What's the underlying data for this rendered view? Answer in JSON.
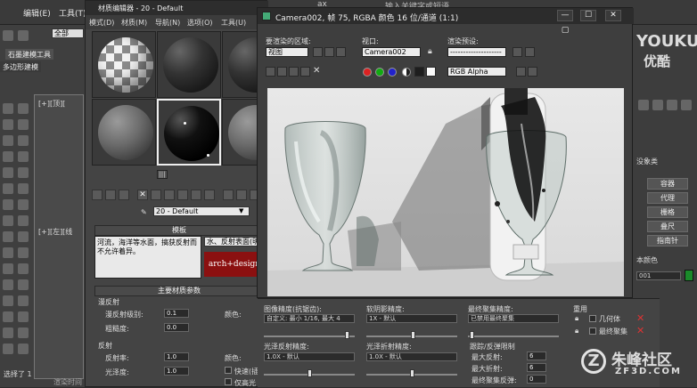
{
  "app": {
    "menu": [
      "编辑(E)",
      "工具(T)"
    ],
    "ribbon_tabs": [
      "石墨建模工具",
      "多边形建模"
    ],
    "field_all": "全部",
    "viewport_labels": [
      "[+][顶][",
      "[+][左][线"
    ],
    "status_text": "选择了 1 ",
    "right_panel_buttons": [
      "容器",
      "代理",
      "栅格",
      "叠尺",
      "指南针"
    ],
    "right_panel_labels": [
      "没象类",
      "本颜色",
      "001"
    ],
    "tab_label": "ax",
    "top_hint": "输入关键字或短语"
  },
  "material_editor": {
    "title": "材质编辑器 - 20 - Default",
    "menu": [
      "模式(D)",
      "材质(M)",
      "导航(N)",
      "选项(O)",
      "工具(U)"
    ],
    "material_name": "20 - Default",
    "rollout_template": "模板",
    "template_text": "河流，海洋等水面，搞获反射而不允许着异。",
    "shader_text": "水、反射表面(明",
    "logo_text": "arch+design",
    "rollout_main": "主要材质参数",
    "section_diffuse": "漫反射",
    "diffuse_level_label": "漫反射级别:",
    "diffuse_level_value": "0.1",
    "roughness_label": "粗糙度:",
    "roughness_value": "0.0",
    "color_label": "颜色:",
    "section_reflect": "反射",
    "reflect_label": "反射率:",
    "reflect_value": "1.0",
    "gloss_label": "光泽度:",
    "gloss_value": "1.0",
    "fast_label": "快速(插",
    "highlight_label": "仅高光",
    "status_small": "渲染时间"
  },
  "render_window": {
    "title": "Camera002, 帧 75, RGBA 颜色 16 位/通道 (1:1)",
    "area_label": "要渲染的区域:",
    "area_value": "视图",
    "viewport_label": "视口:",
    "viewport_value": "Camera002",
    "preset_label": "渲染预设:",
    "preset_value": "--------------------",
    "channel_value": "RGB Alpha",
    "minimize_icon": "—",
    "maximize_icon": "☐",
    "close_icon": "✕",
    "win_extra_icon": "▢"
  },
  "render_settings": {
    "aa_label": "图像精度(抗锯齿):",
    "aa_value": "自定义: 最小 1/16, 最大 4",
    "soft_shadow_label": "软阴影精度:",
    "soft_shadow_value": "1X - 默认",
    "final_gather_label": "最终聚集精度:",
    "final_gather_value": "已禁用最终聚集",
    "reuse_label": "重用",
    "geom_label": "几何体",
    "fg_label": "最终聚集",
    "glossy_reflect_label": "光泽反射精度:",
    "glossy_reflect_value": "1.0X - 默认",
    "glossy_refract_label": "光泽折射精度:",
    "glossy_refract_value": "1.0X - 默认",
    "trace_label": "跟踪/反弹限制",
    "max_reflect_label": "最大反射:",
    "max_reflect_value": "6",
    "max_refract_label": "最大折射:",
    "max_refract_value": "6",
    "fg_bounce_label": "最终聚集反弹:",
    "fg_bounce_value": "0"
  },
  "watermarks": {
    "youku": "YOUKU",
    "youku_cn": "优酷",
    "zf3d_cn": "朱峰社区",
    "zf3d_url": "ZF3D.COM"
  },
  "colors": {
    "render_bg": "#e3e3e3",
    "red_dot": "#d22",
    "green_dot": "#1a1",
    "blue_dot": "#22c"
  }
}
